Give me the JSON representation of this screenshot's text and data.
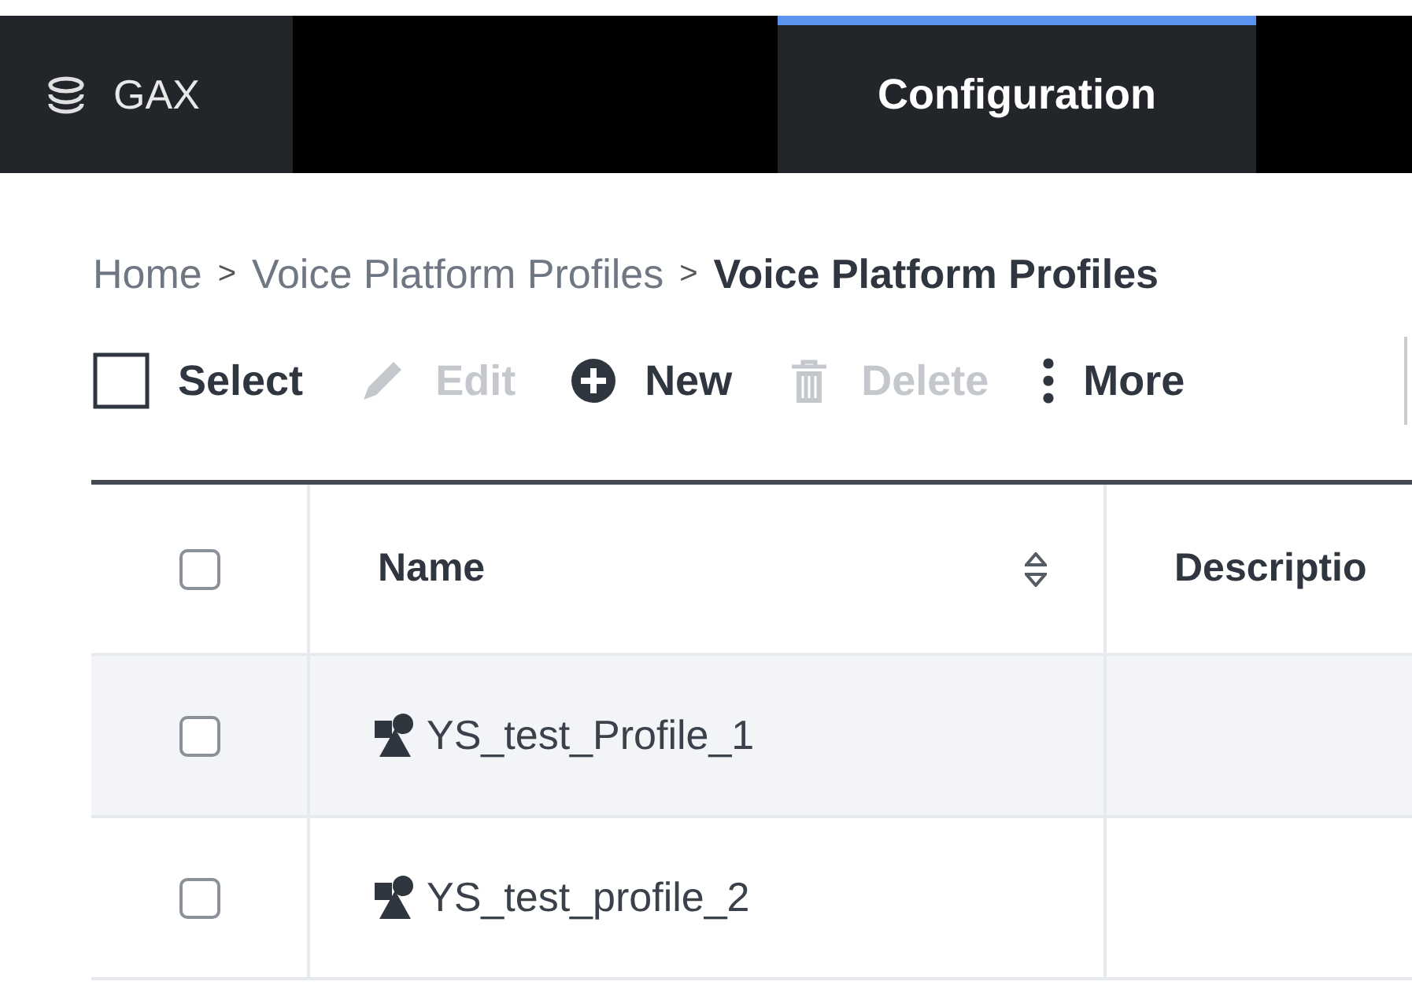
{
  "app": {
    "name": "GAX"
  },
  "nav_tabs": [
    {
      "label": "Configuration",
      "selected": true
    }
  ],
  "breadcrumb": [
    {
      "label": "Home",
      "current": false
    },
    {
      "label": "Voice Platform Profiles",
      "current": false
    },
    {
      "label": "Voice Platform Profiles",
      "current": true
    }
  ],
  "breadcrumb_separator": ">",
  "toolbar": [
    {
      "kind": "select",
      "label": "Select",
      "checked": false
    },
    {
      "kind": "edit",
      "label": "Edit",
      "disabled": true
    },
    {
      "kind": "new",
      "label": "New",
      "disabled": false
    },
    {
      "kind": "delete",
      "label": "Delete",
      "disabled": true
    },
    {
      "kind": "more",
      "label": "More",
      "disabled": false
    }
  ],
  "table": {
    "header_checkbox": {
      "checked": false
    },
    "columns": [
      {
        "label": "Name",
        "sortable": true
      },
      {
        "label": "Descriptio"
      }
    ],
    "rows": [
      {
        "name": "YS_test_Profile_1",
        "checked": false,
        "highlighted": true
      },
      {
        "name": "YS_test_profile_2",
        "checked": false,
        "highlighted": false
      }
    ]
  }
}
